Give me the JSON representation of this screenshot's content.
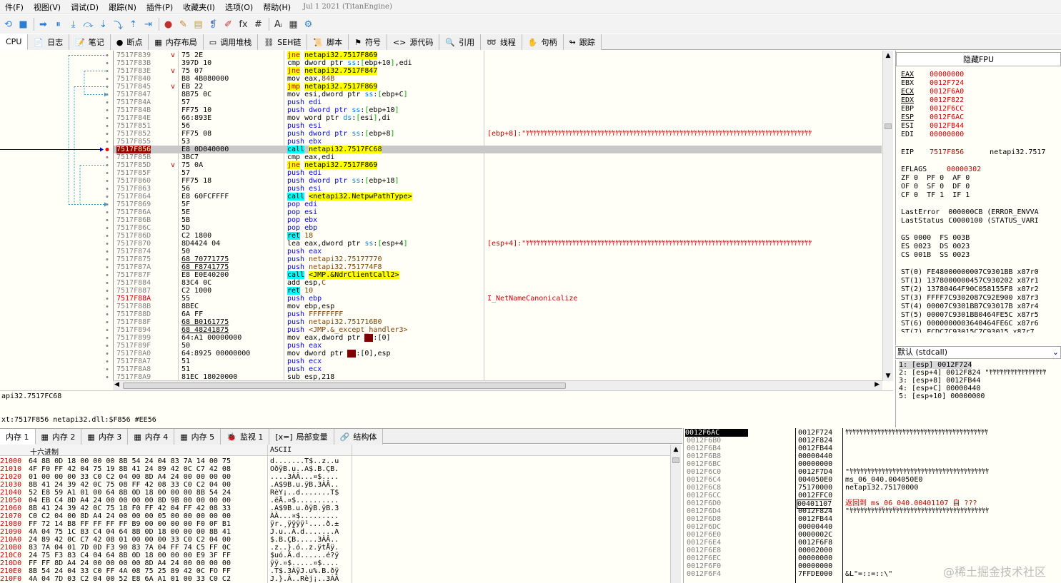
{
  "menu": [
    "件(F)",
    "视图(V)",
    "调试(D)",
    "跟踪(N)",
    "插件(P)",
    "收藏夹(I)",
    "选项(O)",
    "帮助(H)"
  ],
  "build_date": "Jul 1 2021 (TitanEngine)",
  "toolbar_icons": [
    "restart-icon",
    "stop-icon",
    "run-icon",
    "pause-icon",
    "step-into-icon",
    "step-over-icon",
    "trace-into-icon",
    "trace-over-icon",
    "execute-till-return-icon",
    "run-to-user-code-icon",
    "record-icon",
    "patch-icon",
    "script-icon",
    "comment-icon",
    "highlight-icon",
    "function-icon",
    "hash-icon",
    "font-icon",
    "calculator-icon",
    "settings-icon"
  ],
  "toolbar_glyphs": [
    "⟲",
    "■",
    "➡",
    "⏸",
    "⤓",
    "⤼",
    "⇣",
    "⤵",
    "⇡",
    "⇥",
    "●",
    "✎",
    "▤",
    "❡",
    "✐",
    "fx",
    "#",
    "Aᵢ",
    "▦",
    "⚙"
  ],
  "tabs": [
    {
      "icon": "cpu-icon",
      "glyph": "",
      "label": "CPU",
      "active": true
    },
    {
      "icon": "log-icon",
      "glyph": "📄",
      "label": "日志"
    },
    {
      "icon": "notes-icon",
      "glyph": "📝",
      "label": "笔记"
    },
    {
      "icon": "breakpoint-icon",
      "glyph": "●",
      "label": "断点"
    },
    {
      "icon": "memory-map-icon",
      "glyph": "▦",
      "label": "内存布局"
    },
    {
      "icon": "call-stack-icon",
      "glyph": "▭",
      "label": "调用堆栈"
    },
    {
      "icon": "seh-icon",
      "glyph": "⛓",
      "label": "SEH链"
    },
    {
      "icon": "script-icon",
      "glyph": "📜",
      "label": "脚本"
    },
    {
      "icon": "symbols-icon",
      "glyph": "⚑",
      "label": "符号"
    },
    {
      "icon": "source-icon",
      "glyph": "<>",
      "label": "源代码"
    },
    {
      "icon": "references-icon",
      "glyph": "🔍",
      "label": "引用"
    },
    {
      "icon": "threads-icon",
      "glyph": "➿",
      "label": "线程"
    },
    {
      "icon": "handles-icon",
      "glyph": "✋",
      "label": "句柄"
    },
    {
      "icon": "trace-icon",
      "glyph": "↬",
      "label": "跟踪"
    }
  ],
  "disasm": [
    {
      "addr": "7517F839",
      "jm": "v",
      "hex": "75 2E",
      "asm": [
        [
          "jcc",
          "jne"
        ],
        [
          "s",
          " "
        ],
        [
          "tgt",
          "netapi32.7517F869"
        ]
      ],
      "cmt": ""
    },
    {
      "addr": "7517F83B",
      "jm": "",
      "hex": "397D 10",
      "asm": [
        [
          "mov",
          "cmp dword ptr "
        ],
        [
          "seg",
          "ss"
        ],
        [
          "mov",
          ":"
        ],
        [
          "br",
          "["
        ],
        [
          "mov",
          "ebp+10"
        ],
        [
          "br",
          "]"
        ],
        [
          "mov",
          ",edi"
        ]
      ],
      "cmt": ""
    },
    {
      "addr": "7517F83E",
      "jm": "v",
      "hex": "75 07",
      "asm": [
        [
          "jcc",
          "jne"
        ],
        [
          "s",
          " "
        ],
        [
          "tgt",
          "netapi32.7517F847"
        ]
      ],
      "cmt": ""
    },
    {
      "addr": "7517F840",
      "jm": "",
      "hex": "B8 4B080000",
      "asm": [
        [
          "mov",
          "mov eax,"
        ],
        [
          "imm",
          "84B"
        ]
      ],
      "cmt": ""
    },
    {
      "addr": "7517F845",
      "jm": "v",
      "hex": "EB 22",
      "asm": [
        [
          "jmp",
          "jmp"
        ],
        [
          "s",
          " "
        ],
        [
          "tgt",
          "netapi32.7517F869"
        ]
      ],
      "cmt": ""
    },
    {
      "addr": "7517F847",
      "jm": "",
      "hex": "8B75 0C",
      "asm": [
        [
          "mov",
          "mov esi,dword ptr "
        ],
        [
          "seg",
          "ss"
        ],
        [
          "mov",
          ":"
        ],
        [
          "br",
          "["
        ],
        [
          "mov",
          "ebp+C"
        ],
        [
          "br",
          "]"
        ]
      ],
      "cmt": ""
    },
    {
      "addr": "7517F84A",
      "jm": "",
      "hex": "57",
      "asm": [
        [
          "push",
          "push edi"
        ]
      ],
      "cmt": ""
    },
    {
      "addr": "7517F84B",
      "jm": "",
      "hex": "FF75 10",
      "asm": [
        [
          "push",
          "push dword ptr "
        ],
        [
          "seg",
          "ss"
        ],
        [
          "mov",
          ":"
        ],
        [
          "br",
          "["
        ],
        [
          "mov",
          "ebp+10"
        ],
        [
          "br",
          "]"
        ]
      ],
      "cmt": ""
    },
    {
      "addr": "7517F84E",
      "jm": "",
      "hex": "66:893E",
      "asm": [
        [
          "mov",
          "mov word ptr "
        ],
        [
          "seg",
          "ds"
        ],
        [
          "mov",
          ":"
        ],
        [
          "br",
          "["
        ],
        [
          "mov",
          "esi"
        ],
        [
          "br",
          "]"
        ],
        [
          "mov",
          ",di"
        ]
      ],
      "cmt": ""
    },
    {
      "addr": "7517F851",
      "jm": "",
      "hex": "56",
      "asm": [
        [
          "push",
          "push esi"
        ]
      ],
      "cmt": ""
    },
    {
      "addr": "7517F852",
      "jm": "",
      "hex": "FF75 08",
      "asm": [
        [
          "push",
          "push dword ptr "
        ],
        [
          "seg",
          "ss"
        ],
        [
          "mov",
          ":"
        ],
        [
          "br",
          "["
        ],
        [
          "mov",
          "ebp+8"
        ],
        [
          "br",
          "]"
        ]
      ],
      "cmt": "[ebp+8]:\"ﾔﾔﾔﾔﾔﾔﾔﾔﾔﾔﾔﾔﾔﾔﾔﾔﾔﾔﾔﾔﾔﾔﾔﾔﾔﾔﾔﾔﾔﾔﾔﾔﾔﾔﾔﾔﾔﾔﾔﾔﾔﾔﾔﾔﾔﾔﾔﾔﾔﾔﾔﾔﾔﾔﾔﾔﾔﾔﾔﾔﾔﾔﾔﾔﾔﾔﾔﾔﾔﾔﾔﾔﾔﾔﾔﾔﾔﾔﾔﾔ"
    },
    {
      "addr": "7517F855",
      "jm": "",
      "hex": "53",
      "asm": [
        [
          "push",
          "push ebx"
        ]
      ],
      "cmt": ""
    },
    {
      "addr": "7517F856",
      "jm": "",
      "hex": "E8 0D040000",
      "asm": [
        [
          "call",
          "call"
        ],
        [
          "s",
          " "
        ],
        [
          "tgt",
          "netapi32.7517FC68"
        ]
      ],
      "cmt": "",
      "sel": true,
      "eip": true
    },
    {
      "addr": "7517F85B",
      "jm": "",
      "hex": "3BC7",
      "asm": [
        [
          "mov",
          "cmp eax,edi"
        ]
      ],
      "cmt": ""
    },
    {
      "addr": "7517F85D",
      "jm": "v",
      "hex": "75 0A",
      "asm": [
        [
          "jcc",
          "jne"
        ],
        [
          "s",
          " "
        ],
        [
          "tgt",
          "netapi32.7517F869"
        ]
      ],
      "cmt": ""
    },
    {
      "addr": "7517F85F",
      "jm": "",
      "hex": "57",
      "asm": [
        [
          "push",
          "push edi"
        ]
      ],
      "cmt": ""
    },
    {
      "addr": "7517F860",
      "jm": "",
      "hex": "FF75 18",
      "asm": [
        [
          "push",
          "push dword ptr "
        ],
        [
          "seg",
          "ss"
        ],
        [
          "mov",
          ":"
        ],
        [
          "br",
          "["
        ],
        [
          "mov",
          "ebp+18"
        ],
        [
          "br",
          "]"
        ]
      ],
      "cmt": ""
    },
    {
      "addr": "7517F863",
      "jm": "",
      "hex": "56",
      "asm": [
        [
          "push",
          "push esi"
        ]
      ],
      "cmt": ""
    },
    {
      "addr": "7517F864",
      "jm": "",
      "hex": "E8 60FCFFFF",
      "asm": [
        [
          "call",
          "call"
        ],
        [
          "s",
          " "
        ],
        [
          "tgt",
          "<netapi32.NetpwPathType>"
        ]
      ],
      "cmt": ""
    },
    {
      "addr": "7517F869",
      "jm": "",
      "hex": "5F",
      "asm": [
        [
          "push",
          "pop edi"
        ]
      ],
      "cmt": ""
    },
    {
      "addr": "7517F86A",
      "jm": "",
      "hex": "5E",
      "asm": [
        [
          "push",
          "pop esi"
        ]
      ],
      "cmt": ""
    },
    {
      "addr": "7517F86B",
      "jm": "",
      "hex": "5B",
      "asm": [
        [
          "push",
          "pop ebx"
        ]
      ],
      "cmt": ""
    },
    {
      "addr": "7517F86C",
      "jm": "",
      "hex": "5D",
      "asm": [
        [
          "push",
          "pop ebp"
        ]
      ],
      "cmt": ""
    },
    {
      "addr": "7517F86D",
      "jm": "",
      "hex": "C2 1800",
      "asm": [
        [
          "ret",
          "ret"
        ],
        [
          "s",
          " "
        ],
        [
          "imm",
          "18"
        ]
      ],
      "cmt": ""
    },
    {
      "addr": "7517F870",
      "jm": "",
      "hex": "8D4424 04",
      "asm": [
        [
          "mov",
          "lea eax,dword ptr "
        ],
        [
          "seg",
          "ss"
        ],
        [
          "mov",
          ":"
        ],
        [
          "br",
          "["
        ],
        [
          "mov",
          "esp+4"
        ],
        [
          "br",
          "]"
        ]
      ],
      "cmt": "[esp+4]:\"ﾔﾔﾔﾔﾔﾔﾔﾔﾔﾔﾔﾔﾔﾔﾔﾔﾔﾔﾔﾔﾔﾔﾔﾔﾔﾔﾔﾔﾔﾔﾔﾔﾔﾔﾔﾔﾔﾔﾔﾔﾔﾔﾔﾔﾔﾔﾔﾔﾔﾔﾔﾔﾔﾔﾔﾔﾔﾔﾔﾔﾔﾔﾔﾔﾔﾔﾔﾔﾔﾔﾔﾔﾔﾔﾔﾔﾔﾔﾔﾔ"
    },
    {
      "addr": "7517F874",
      "jm": "",
      "hex": "50",
      "asm": [
        [
          "push",
          "push eax"
        ]
      ],
      "cmt": ""
    },
    {
      "addr": "7517F875",
      "jm": "",
      "hex": "68 70771775",
      "ul": true,
      "asm": [
        [
          "push",
          "push "
        ],
        [
          "imm",
          "netapi32.75177770"
        ]
      ],
      "cmt": ""
    },
    {
      "addr": "7517F87A",
      "jm": "",
      "hex": "68 F8741775",
      "ul": true,
      "asm": [
        [
          "push",
          "push "
        ],
        [
          "imm",
          "netapi32.751774F8"
        ]
      ],
      "cmt": ""
    },
    {
      "addr": "7517F87F",
      "jm": "",
      "hex": "E8 E0E40200",
      "asm": [
        [
          "call",
          "call"
        ],
        [
          "s",
          " "
        ],
        [
          "tgt",
          "<JMP.&NdrClientCall2>"
        ]
      ],
      "cmt": ""
    },
    {
      "addr": "7517F884",
      "jm": "",
      "hex": "83C4 0C",
      "asm": [
        [
          "mov",
          "add esp,"
        ],
        [
          "imm",
          "C"
        ]
      ],
      "cmt": ""
    },
    {
      "addr": "7517F887",
      "jm": "",
      "hex": "C2 1000",
      "asm": [
        [
          "ret",
          "ret"
        ],
        [
          "s",
          " "
        ],
        [
          "imm",
          "10"
        ]
      ],
      "cmt": ""
    },
    {
      "addr": "7517F88A",
      "jm": "",
      "hex": "55",
      "asm": [
        [
          "push",
          "push ebp"
        ]
      ],
      "cmt": "I_NetNameCanonicalize",
      "red": true
    },
    {
      "addr": "7517F88B",
      "jm": "",
      "hex": "8BEC",
      "asm": [
        [
          "mov",
          "mov ebp,esp"
        ]
      ],
      "cmt": ""
    },
    {
      "addr": "7517F88D",
      "jm": "",
      "hex": "6A FF",
      "asm": [
        [
          "push",
          "push "
        ],
        [
          "imm",
          "FFFFFFFF"
        ]
      ],
      "cmt": ""
    },
    {
      "addr": "7517F88F",
      "jm": "",
      "hex": "68 B0161775",
      "ul": true,
      "asm": [
        [
          "push",
          "push "
        ],
        [
          "imm",
          "netapi32.751716B0"
        ]
      ],
      "cmt": ""
    },
    {
      "addr": "7517F894",
      "jm": "",
      "hex": "68 48241875",
      "ul": true,
      "asm": [
        [
          "push",
          "push "
        ],
        [
          "imm",
          "<JMP.&_except_handler3>"
        ]
      ],
      "cmt": ""
    },
    {
      "addr": "7517F899",
      "jm": "",
      "hex": "64:A1 00000000",
      "asm": [
        [
          "mov",
          "mov eax,dword ptr "
        ],
        [
          "segd",
          "fs"
        ],
        [
          "mov",
          ":[0]"
        ]
      ],
      "cmt": ""
    },
    {
      "addr": "7517F89F",
      "jm": "",
      "hex": "50",
      "asm": [
        [
          "push",
          "push eax"
        ]
      ],
      "cmt": ""
    },
    {
      "addr": "7517F8A0",
      "jm": "",
      "hex": "64:8925 00000000",
      "asm": [
        [
          "mov",
          "mov dword ptr "
        ],
        [
          "segd",
          "fs"
        ],
        [
          "mov",
          ":[0],esp"
        ]
      ],
      "cmt": ""
    },
    {
      "addr": "7517F8A7",
      "jm": "",
      "hex": "51",
      "asm": [
        [
          "push",
          "push ecx"
        ]
      ],
      "cmt": ""
    },
    {
      "addr": "7517F8A8",
      "jm": "",
      "hex": "51",
      "asm": [
        [
          "push",
          "push ecx"
        ]
      ],
      "cmt": ""
    },
    {
      "addr": "7517F8A9",
      "jm": "",
      "hex": "81EC 18020000",
      "asm": [
        [
          "mov",
          "sub esp,218"
        ]
      ],
      "cmt": ""
    }
  ],
  "info_lines": [
    "api32.7517FC68",
    "xt:7517F856 netapi32.dll:$F856 #EE56"
  ],
  "registers": {
    "title": "隐藏FPU",
    "gp": [
      [
        "EAX",
        "00000000",
        true
      ],
      [
        "EBX",
        "0012F724",
        false
      ],
      [
        "ECX",
        "0012F6A0",
        true
      ],
      [
        "EDX",
        "0012F822",
        true
      ],
      [
        "EBP",
        "0012F6CC",
        false
      ],
      [
        "ESP",
        "0012F6AC",
        true
      ],
      [
        "ESI",
        "0012FB44",
        false
      ],
      [
        "EDI",
        "00000000",
        false
      ]
    ],
    "eip": [
      "EIP",
      "7517F856",
      "netapi32.7517"
    ],
    "eflags": [
      "EFLAGS",
      "00000302"
    ],
    "flags": [
      "ZF 0  PF 0  AF 0",
      "OF 0  SF 0  DF 0",
      "CF 0  TF 1  IF 1"
    ],
    "lasterror": "LastError  000000CB (ERROR_ENVVA",
    "laststatus": "LastStatus C0000100 (STATUS_VARI",
    "segs": [
      "GS 0000  FS 003B",
      "ES 0023  DS 0023",
      "CS 001B  SS 0023"
    ],
    "fpu": [
      "ST(0) FE48000000007C9301BB x87r0",
      "ST(1) 1378000000457C930202 x87r1",
      "ST(2) 13780464F90C058155F8 x87r2",
      "ST(3) FFFF7C9302087C92E900 x87r3",
      "ST(4) 00007C9301BB7C93017B x87r4",
      "ST(5) 00007C9301BB0464FE5C x87r5",
      "ST(6) 0000000003640464FE6C x87r6",
      "ST(7) FCDC7C93015C7C93015 x87r7"
    ]
  },
  "callconv": "默认 (stdcall)",
  "stack_args": [
    "1: [esp] 0012F724",
    "2: [esp+4] 0012F824 \"ﾔﾔﾔﾔﾔﾔﾔﾔﾔﾔﾔﾔﾔﾔﾔﾔ",
    "3: [esp+8] 0012FB44",
    "4: [esp+C] 00000440",
    "5: [esp+10] 00000000"
  ],
  "bottom_tabs": [
    {
      "icon": "memory-icon",
      "glyph": "▦",
      "label": "内存 1",
      "active": true
    },
    {
      "icon": "memory-icon",
      "glyph": "▦",
      "label": "内存 2"
    },
    {
      "icon": "memory-icon",
      "glyph": "▦",
      "label": "内存 3"
    },
    {
      "icon": "memory-icon",
      "glyph": "▦",
      "label": "内存 4"
    },
    {
      "icon": "memory-icon",
      "glyph": "▦",
      "label": "内存 5"
    },
    {
      "icon": "watch-icon",
      "glyph": "🐞",
      "label": "监视 1"
    },
    {
      "icon": "locals-icon",
      "glyph": "[x=]",
      "label": "局部变量"
    },
    {
      "icon": "struct-icon",
      "glyph": "🔗",
      "label": "结构体"
    }
  ],
  "dump": {
    "hdr_hex": "十六进制",
    "hdr_ascii": "ASCII",
    "rows": [
      [
        "21000",
        "64 8B 0D 18 00 00 00 8B 54 24 04 83 7A 14 00 75",
        "d.......T$..z..u"
      ],
      [
        "21010",
        "4F F0 FF 42 04 75 19 8B 41 24 89 42 0C C7 42 08",
        "OðÿB.u..A$.B.ÇB."
      ],
      [
        "21020",
        "01 00 00 00 33 C0 C2 04 00 8D A4 24 00 00 00 00",
        "....3ÀÂ...¤$...."
      ],
      [
        "21030",
        "8B 41 24 39 42 0C 75 08 FF 42 08 33 C0 C2 04 00",
        ".A$9B.u.ÿB.3ÀÂ.."
      ],
      [
        "21040",
        "52 E8 59 A1 01 00 64 8B 0D 18 00 00 00 8B 54 24",
        "RèY¡..d.......T$"
      ],
      [
        "21050",
        "04 EB C4 8D A4 24 00 00 00 00 8D 9B 00 00 00 00",
        ".ëÄ.¤$.........."
      ],
      [
        "21060",
        "8B 41 24 39 42 0C 75 18 F0 FF 42 04 FF 42 08 33",
        ".A$9B.u.ðÿB.ÿB.3"
      ],
      [
        "21070",
        "C0 C2 04 00 8D A4 24 00 00 00 05 00 00 00 00 00",
        "ÀÂ...¤$........."
      ],
      [
        "21080",
        "FF 72 14 B8 FF FF FF FF B9 00 00 00 00 F0 0F B1",
        "ÿr.¸ÿÿÿÿ¹....ð.±"
      ],
      [
        "21090",
        "4A 04 75 1C 83 C4 04 64 8B 0D 18 00 00 00 8B 41",
        "J.u..Ä.d.......A"
      ],
      [
        "210A0",
        "24 89 42 0C C7 42 08 01 00 00 00 33 C0 C2 04 00",
        "$.B.ÇB.....3ÀÂ.."
      ],
      [
        "210B0",
        "83 7A 04 01 7D 0D F3 90 83 7A 04 FF 74 C5 FF 0C",
        ".z..}.ó..z.ÿtÅÿ."
      ],
      [
        "210C0",
        "24 75 F3 83 C4 04 64 8B 0D 18 00 00 00 E9 3F FF",
        "$uó.Ä.d......é?ÿ"
      ],
      [
        "210D0",
        "FF FF 8D A4 24 00 00 00 00 8D A4 24 00 00 00 00",
        "ÿÿ.¤$.....¤$...."
      ],
      [
        "210E0",
        "8B 54 24 04 33 C0 FF 4A 08 75 25 89 42 0C FO FF",
        ".T$.3ÀÿJ.u%.B.ðÿ"
      ],
      [
        "210F0",
        "4A 04 7D 03 C2 04 00 52 E8 6A A1 01 00 33 C0 C2",
        "J.}.Â..Rèj¡..3ÀÂ"
      ]
    ]
  },
  "stack": [
    [
      "0012F6AC",
      "0012F724",
      "ﾔﾔﾔﾔﾔﾔﾔﾔﾔﾔﾔﾔﾔﾔﾔﾔﾔﾔﾔﾔﾔﾔﾔﾔﾔﾔﾔﾔﾔﾔﾔﾔﾔﾔﾔﾔﾔﾔﾔﾔ",
      false
    ],
    [
      "0012F6B0",
      "0012F824",
      "",
      false
    ],
    [
      "0012F6B4",
      "0012FB44",
      "",
      false
    ],
    [
      "0012F6B8",
      "00000440",
      "",
      false
    ],
    [
      "0012F6BC",
      "00000000",
      "",
      false
    ],
    [
      "0012F6C0",
      "0012F7D4",
      "\"ﾔﾔﾔﾔﾔﾔﾔﾔﾔﾔﾔﾔﾔﾔﾔﾔﾔﾔﾔﾔﾔﾔﾔﾔﾔﾔﾔﾔﾔﾔﾔﾔﾔﾔﾔﾔﾔﾔﾔ",
      false
    ],
    [
      "0012F6C4",
      "004050E0",
      "ms_06_040.004050E0",
      false
    ],
    [
      "0012F6C8",
      "75170000",
      "netapi32.75170000",
      false
    ],
    [
      "0012F6CC",
      "0012FFC0",
      "",
      false
    ],
    [
      "0012F6D0",
      "00401107",
      "返回到 ms_06_040.00401107 自 ???",
      true
    ],
    [
      "0012F6D4",
      "0012F824",
      "\"ﾔﾔﾔﾔﾔﾔﾔﾔﾔﾔﾔﾔﾔﾔﾔﾔﾔﾔﾔﾔﾔﾔﾔﾔﾔﾔﾔﾔﾔﾔﾔﾔﾔﾔﾔﾔﾔﾔﾔ",
      false
    ],
    [
      "0012F6D8",
      "0012FB44",
      "",
      false
    ],
    [
      "0012F6DC",
      "00000440",
      "",
      false
    ],
    [
      "0012F6E0",
      "0000002C",
      "",
      false
    ],
    [
      "0012F6E4",
      "0012F6F8",
      "",
      false
    ],
    [
      "0012F6E8",
      "00002000",
      "",
      false
    ],
    [
      "0012F6EC",
      "00000000",
      "",
      false
    ],
    [
      "0012F6F0",
      "00000000",
      "",
      false
    ],
    [
      "0012F6F4",
      "7FFDE000",
      "&L\"=::=::\\\"",
      false
    ]
  ],
  "watermark": "@稀土掘金技术社区",
  "colors": {
    "accent": "#c00000",
    "sel": "#c8c8c8",
    "yellow": "#ffff00",
    "cyan": "#00ffff"
  }
}
